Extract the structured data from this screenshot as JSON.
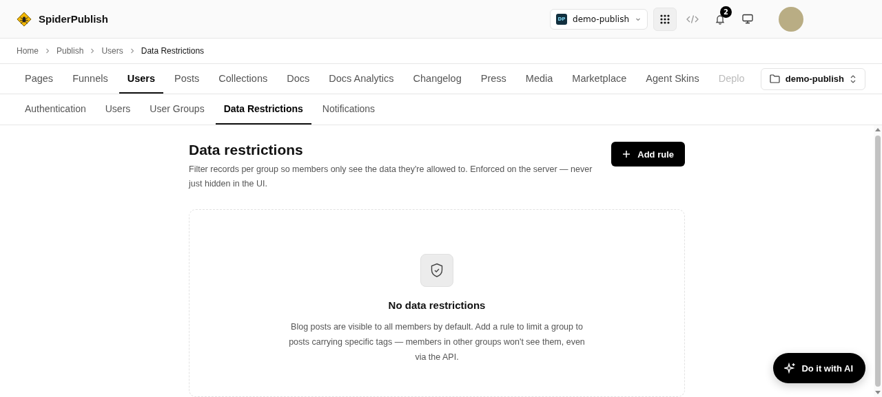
{
  "app": {
    "name": "SpiderPublish"
  },
  "header": {
    "project": {
      "badge": "DP",
      "name": "demo-publish"
    },
    "notifications": {
      "count": "2"
    }
  },
  "breadcrumb": [
    "Home",
    "Publish",
    "Users",
    "Data Restrictions"
  ],
  "tabs": [
    {
      "label": "Pages",
      "selected": false
    },
    {
      "label": "Funnels",
      "selected": false
    },
    {
      "label": "Users",
      "selected": true
    },
    {
      "label": "Posts",
      "selected": false
    },
    {
      "label": "Collections",
      "selected": false
    },
    {
      "label": "Docs",
      "selected": false
    },
    {
      "label": "Docs Analytics",
      "selected": false
    },
    {
      "label": "Changelog",
      "selected": false
    },
    {
      "label": "Press",
      "selected": false
    },
    {
      "label": "Media",
      "selected": false
    },
    {
      "label": "Marketplace",
      "selected": false
    },
    {
      "label": "Agent Skins",
      "selected": false
    },
    {
      "label": "Deplo",
      "selected": false
    }
  ],
  "site_selector": {
    "name": "demo-publish"
  },
  "subtabs": [
    {
      "label": "Authentication",
      "selected": false
    },
    {
      "label": "Users",
      "selected": false
    },
    {
      "label": "User Groups",
      "selected": false
    },
    {
      "label": "Data Restrictions",
      "selected": true
    },
    {
      "label": "Notifications",
      "selected": false
    }
  ],
  "page": {
    "title": "Data restrictions",
    "description": "Filter records per group so members only see the data they're allowed to. Enforced on the server — never just hidden in the UI.",
    "action": "Add rule"
  },
  "empty_state": {
    "title": "No data restrictions",
    "text": "Blog posts are visible to all members by default. Add a rule to limit a group to posts carrying specific tags — members in other groups won't see them, even via the API."
  },
  "ai_button": {
    "label": "Do it with AI"
  }
}
